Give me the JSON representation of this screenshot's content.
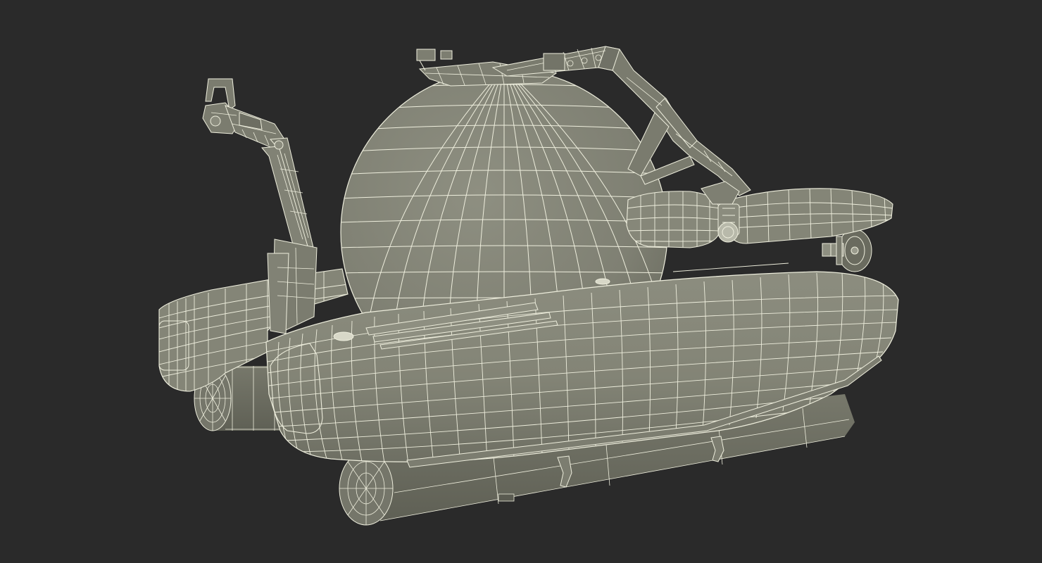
{
  "scene": {
    "background_color": "#2a2a2a",
    "surface_color": "#868779",
    "surface_shadow_color": "#6a6b5f",
    "surface_dark_color": "#55564c",
    "wire_color": "#eeeedd",
    "subject": "submarine-wireframe-model",
    "render_style": "wireframe-on-shaded"
  }
}
